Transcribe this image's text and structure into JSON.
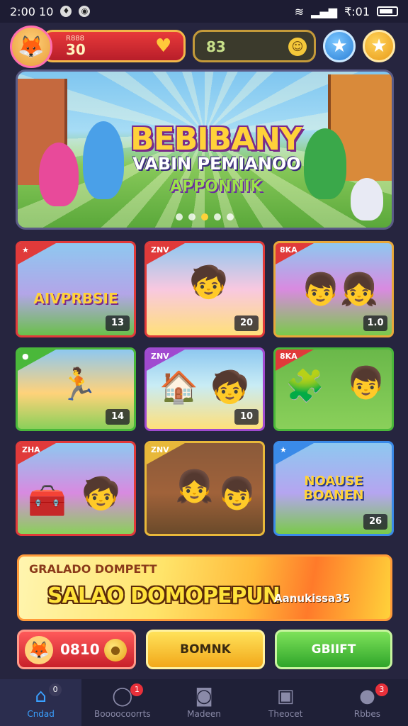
{
  "status_bar": {
    "time": "2:00 10",
    "clock_right": "₹:01"
  },
  "header": {
    "coins_label": "R888",
    "coins_value": "30",
    "gems_value": "83",
    "star_icon": "star-icon",
    "favorite_icon": "star-icon"
  },
  "banner": {
    "title_line1": "BEBIBANY",
    "title_line2": "VABIN PEMIANOO",
    "title_line3": "APPONNIK",
    "dots": 5
  },
  "cards": [
    {
      "ribbon": "★",
      "label": "AIVPRBSIE",
      "count": "13",
      "colors": [
        "#e03a3a",
        "#b3a5e8"
      ]
    },
    {
      "ribbon": "ZNV",
      "label": "",
      "count": "20",
      "colors": [
        "#e03a3a",
        "#f8c8e0"
      ]
    },
    {
      "ribbon": "8KA",
      "label": "",
      "count": "1.0",
      "colors": [
        "#e8a83a",
        "#d98ae0"
      ]
    },
    {
      "ribbon": "●",
      "label": "",
      "count": "14",
      "colors": [
        "#4ab83a",
        "#ffd27a"
      ]
    },
    {
      "ribbon": "ZNV",
      "label": "",
      "count": "10",
      "colors": [
        "#a04ad0",
        "#c8ecf5"
      ]
    },
    {
      "ribbon": "8KA",
      "label": "",
      "count": "",
      "colors": [
        "#4ab83a",
        "#8ad05a"
      ]
    },
    {
      "ribbon": "ZHA",
      "label": "",
      "count": "",
      "colors": [
        "#e03a3a",
        "#d88ae0"
      ]
    },
    {
      "ribbon": "ZNV",
      "label": "",
      "count": "",
      "colors": [
        "#e8b83a",
        "#a0623a"
      ]
    },
    {
      "ribbon": "★",
      "label": "NOAUSE BOANEN",
      "count": "26",
      "colors": [
        "#3a8ae8",
        "#b5a5f0"
      ]
    }
  ],
  "promo": {
    "subtitle": "GRALADO DOMPETT",
    "headline": "SALAO DOMOPEPUN",
    "side_text": "Aanukissa35"
  },
  "actions": {
    "profile_value": "0810",
    "middle_label": "BOMNK",
    "right_label": "GBIIFT"
  },
  "nav": [
    {
      "label": "Cndad",
      "icon": "home-icon",
      "badge": "0",
      "active": true
    },
    {
      "label": "Boooocoorrts",
      "icon": "chat-icon",
      "badge": "1",
      "active": false
    },
    {
      "label": "Madeen",
      "icon": "trophy-icon",
      "badge": "",
      "active": false
    },
    {
      "label": "Theocet",
      "icon": "box-icon",
      "badge": "",
      "active": false
    },
    {
      "label": "Rbbes",
      "icon": "profile-icon",
      "badge": "3",
      "active": false
    }
  ]
}
